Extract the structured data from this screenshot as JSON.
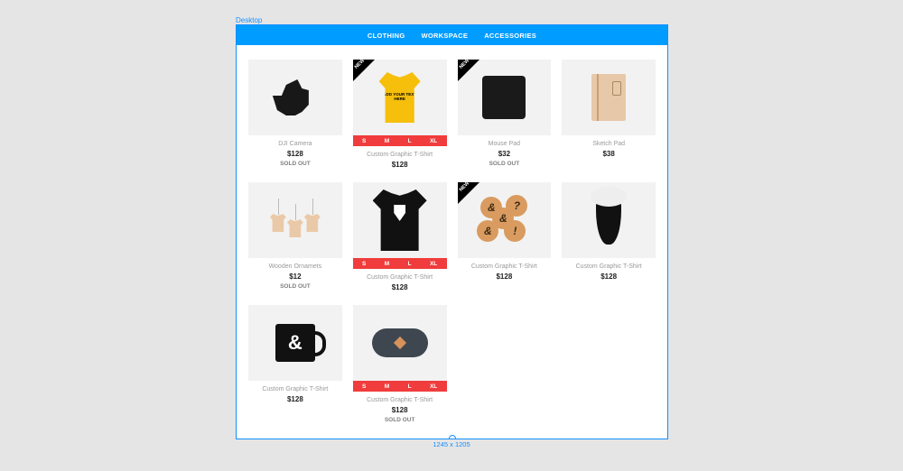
{
  "canvas": {
    "breakpoint_label": "Desktop",
    "dimensions": "1245 x 1205"
  },
  "nav": {
    "items": [
      "CLOTHING",
      "WORKSPACE",
      "ACCESSORIES"
    ]
  },
  "sizes": [
    "S",
    "M",
    "L",
    "XL"
  ],
  "products": [
    {
      "name": "DJI Camera",
      "price": "$128",
      "sold_out": true,
      "new": false,
      "sizes": false,
      "art": "p-camera"
    },
    {
      "name": "Custom Graphic T-Shirt",
      "price": "$128",
      "sold_out": false,
      "new": true,
      "sizes": true,
      "art": "p-shirt-y"
    },
    {
      "name": "Mouse Pad",
      "price": "$32",
      "sold_out": true,
      "new": true,
      "sizes": false,
      "art": "p-pad"
    },
    {
      "name": "Sketch Pad",
      "price": "$38",
      "sold_out": false,
      "new": false,
      "sizes": false,
      "art": "p-sketch"
    },
    {
      "name": "Wooden Ornamets",
      "price": "$12",
      "sold_out": true,
      "new": false,
      "sizes": false,
      "art": "p-orn"
    },
    {
      "name": "Custom Graphic T-Shirt",
      "price": "$128",
      "sold_out": false,
      "new": false,
      "sizes": true,
      "art": "p-shirt-b"
    },
    {
      "name": "Custom Graphic T-Shirt",
      "price": "$128",
      "sold_out": false,
      "new": true,
      "sizes": false,
      "art": "p-coasters"
    },
    {
      "name": "Custom Graphic T-Shirt",
      "price": "$128",
      "sold_out": false,
      "new": false,
      "sizes": false,
      "art": "p-vase"
    },
    {
      "name": "Custom Graphic T-Shirt",
      "price": "$128",
      "sold_out": false,
      "new": false,
      "sizes": false,
      "art": "p-mug"
    },
    {
      "name": "Custom Graphic T-Shirt",
      "price": "$128",
      "sold_out": true,
      "new": false,
      "sizes": true,
      "art": "p-pouch"
    }
  ],
  "labels": {
    "sold_out": "SOLD OUT",
    "new": "NEW",
    "shirt_text": "ADD YOUR TEXT HERE"
  }
}
